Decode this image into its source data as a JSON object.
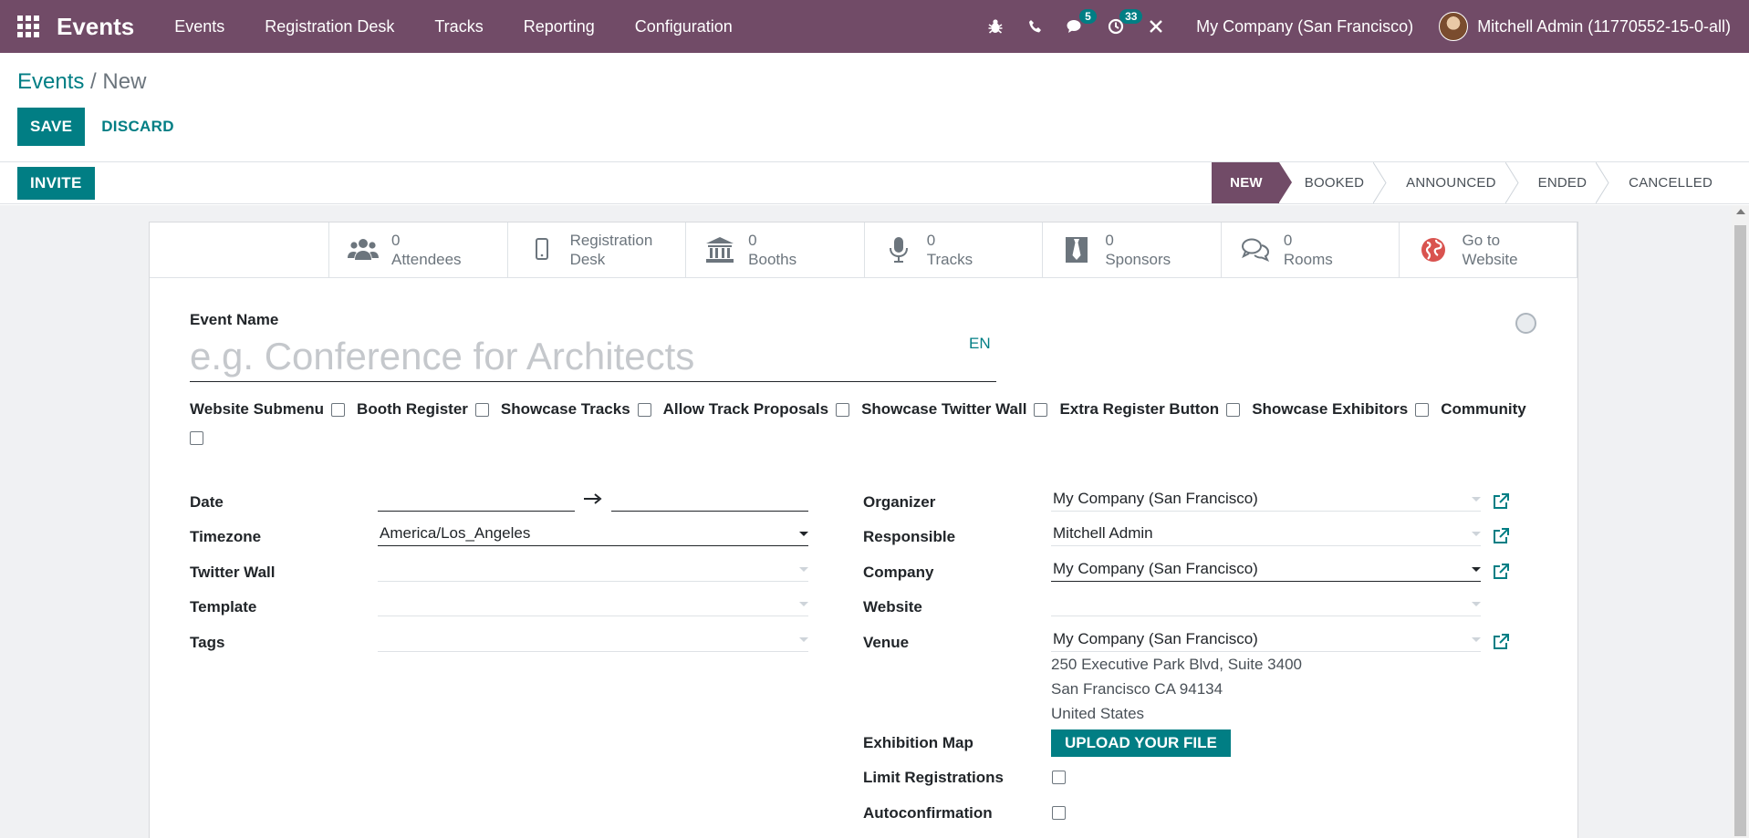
{
  "navbar": {
    "brand": "Events",
    "menu": [
      "Events",
      "Registration Desk",
      "Tracks",
      "Reporting",
      "Configuration"
    ],
    "messages_count": "5",
    "activities_count": "33",
    "company": "My Company (San Francisco)",
    "user": "Mitchell Admin (11770552-15-0-all)"
  },
  "breadcrumb": {
    "parent": "Events",
    "separator": "/",
    "current": "New"
  },
  "actions": {
    "save": "SAVE",
    "discard": "DISCARD",
    "invite": "INVITE"
  },
  "stages": [
    "NEW",
    "BOOKED",
    "ANNOUNCED",
    "ENDED",
    "CANCELLED"
  ],
  "smart_buttons": [
    {
      "value": "0",
      "label": "Attendees",
      "icon": "users-icon"
    },
    {
      "value": "Registration",
      "label": "Desk",
      "icon": "mobile-icon"
    },
    {
      "value": "0",
      "label": "Booths",
      "icon": "bank-icon"
    },
    {
      "value": "0",
      "label": "Tracks",
      "icon": "microphone-icon"
    },
    {
      "value": "0",
      "label": "Sponsors",
      "icon": "tie-icon"
    },
    {
      "value": "0",
      "label": "Rooms",
      "icon": "comments-icon"
    },
    {
      "value": "Go to",
      "label": "Website",
      "icon": "globe-icon"
    }
  ],
  "form": {
    "event_name_label": "Event Name",
    "event_name_placeholder": "e.g. Conference for Architects",
    "lang": "EN",
    "options": [
      "Website Submenu",
      "Booth Register",
      "Showcase Tracks",
      "Allow Track Proposals",
      "Showcase Twitter Wall",
      "Extra Register Button",
      "Showcase Exhibitors",
      "Community"
    ],
    "left": {
      "date_label": "Date",
      "timezone_label": "Timezone",
      "timezone_value": "America/Los_Angeles",
      "twitter_wall_label": "Twitter Wall",
      "template_label": "Template",
      "tags_label": "Tags"
    },
    "right": {
      "organizer_label": "Organizer",
      "organizer_value": "My Company (San Francisco)",
      "responsible_label": "Responsible",
      "responsible_value": "Mitchell Admin",
      "company_label": "Company",
      "company_value": "My Company (San Francisco)",
      "website_label": "Website",
      "venue_label": "Venue",
      "venue_value": "My Company (San Francisco)",
      "venue_address": [
        "250 Executive Park Blvd, Suite 3400",
        "San Francisco CA 94134",
        "United States"
      ],
      "exhibition_map_label": "Exhibition Map",
      "upload_label": "UPLOAD YOUR FILE",
      "limit_label": "Limit Registrations",
      "autoconfirm_label": "Autoconfirmation"
    }
  },
  "colors": {
    "brand": "#714B67",
    "accent": "#017E84"
  }
}
